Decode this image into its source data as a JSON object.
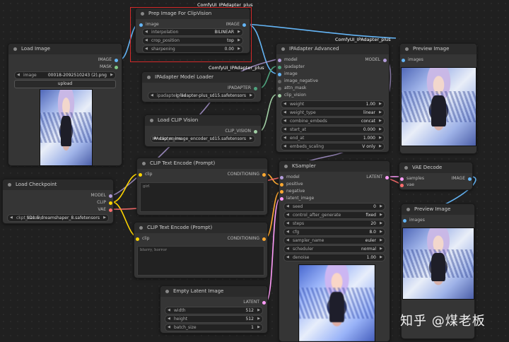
{
  "colors": {
    "model": "#b39ddb",
    "clip": "#ffd500",
    "vae": "#ff6e6e",
    "image": "#64b5f6",
    "mask": "#81c784",
    "ipadapter": "#4fa37e",
    "clipvision": "#a1cfa5",
    "conditioning": "#ffa931",
    "latent": "#ff9cf9",
    "selection": "#d42a2a"
  },
  "wire_labels": {
    "top": "ComfyUI_IPAdapter_plus",
    "right": "ComfyUI_IPAdapter_plus",
    "mid": "ComfyUI_IPAdapter_plus"
  },
  "prep": {
    "title": "Prep Image For ClipVision",
    "in_image": "image",
    "out_image": "IMAGE",
    "interpolation_label": "interpolation",
    "interpolation_value": "BILINEAR",
    "crop_label": "crop_position",
    "crop_value": "top",
    "sharpening_label": "sharpening",
    "sharpening_value": "0.00"
  },
  "load_image": {
    "title": "Load Image",
    "out_image": "IMAGE",
    "out_mask": "MASK",
    "image_label": "image",
    "image_value": "00018-2092510243 (2).png",
    "upload_label": "upload"
  },
  "ipa_loader": {
    "title": "IPAdapter Model Loader",
    "out": "IPADAPTER",
    "file_label": "ipadapter_file",
    "file_value": "ip-adapter-plus_sd15.safetensors"
  },
  "clip_vision": {
    "title": "Load CLIP Vision",
    "out": "CLIP_VISION",
    "name_label": "clip_name",
    "name_value": "IPAdapter_image_encoder_sd15.safetensors"
  },
  "ipa_adv": {
    "title": "IPAdapter Advanced",
    "inputs": [
      "model",
      "ipadapter",
      "image",
      "image_negative",
      "attn_mask",
      "clip_vision"
    ],
    "out_model": "MODEL",
    "widgets": [
      {
        "label": "weight",
        "value": "1.00"
      },
      {
        "label": "weight_type",
        "value": "linear"
      },
      {
        "label": "combine_embeds",
        "value": "concat"
      },
      {
        "label": "start_at",
        "value": "0.000"
      },
      {
        "label": "end_at",
        "value": "1.000"
      },
      {
        "label": "embeds_scaling",
        "value": "V only"
      }
    ]
  },
  "preview1": {
    "title": "Preview Image",
    "in": "images"
  },
  "checkpoint": {
    "title": "Load Checkpoint",
    "out_model": "MODEL",
    "out_clip": "CLIP",
    "out_vae": "VAE",
    "ckpt_label": "ckpt_name",
    "ckpt_value": "SD1.5\\dreamshaper_8.safetensors"
  },
  "clip_pos": {
    "title": "CLIP Text Encode (Prompt)",
    "in": "clip",
    "out": "CONDITIONING",
    "text": "girl"
  },
  "clip_neg": {
    "title": "CLIP Text Encode (Prompt)",
    "in": "clip",
    "out": "CONDITIONING",
    "text": "blurry, horror"
  },
  "ksampler": {
    "title": "KSampler",
    "inputs": [
      "model",
      "positive",
      "negative",
      "latent_image"
    ],
    "out": "LATENT",
    "widgets": [
      {
        "label": "seed",
        "value": "0"
      },
      {
        "label": "control_after_generate",
        "value": "fixed"
      },
      {
        "label": "steps",
        "value": "20"
      },
      {
        "label": "cfg",
        "value": "8.0"
      },
      {
        "label": "sampler_name",
        "value": "euler"
      },
      {
        "label": "scheduler",
        "value": "normal"
      },
      {
        "label": "denoise",
        "value": "1.00"
      }
    ]
  },
  "vae_decode": {
    "title": "VAE Decode",
    "in_samples": "samples",
    "in_vae": "vae",
    "out": "IMAGE"
  },
  "preview2": {
    "title": "Preview Image",
    "in": "images"
  },
  "latent": {
    "title": "Empty Latent Image",
    "out": "LATENT",
    "widgets": [
      {
        "label": "width",
        "value": "512"
      },
      {
        "label": "height",
        "value": "512"
      },
      {
        "label": "batch_size",
        "value": "1"
      }
    ]
  },
  "watermark": "知乎 @煤老板"
}
